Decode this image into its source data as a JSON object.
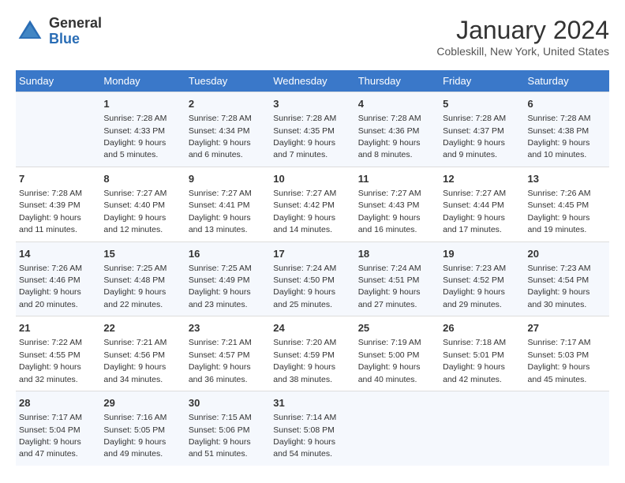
{
  "header": {
    "logo_general": "General",
    "logo_blue": "Blue",
    "month_title": "January 2024",
    "location": "Cobleskill, New York, United States"
  },
  "weekdays": [
    "Sunday",
    "Monday",
    "Tuesday",
    "Wednesday",
    "Thursday",
    "Friday",
    "Saturday"
  ],
  "weeks": [
    [
      {
        "day": "",
        "info": ""
      },
      {
        "day": "1",
        "info": "Sunrise: 7:28 AM\nSunset: 4:33 PM\nDaylight: 9 hours\nand 5 minutes."
      },
      {
        "day": "2",
        "info": "Sunrise: 7:28 AM\nSunset: 4:34 PM\nDaylight: 9 hours\nand 6 minutes."
      },
      {
        "day": "3",
        "info": "Sunrise: 7:28 AM\nSunset: 4:35 PM\nDaylight: 9 hours\nand 7 minutes."
      },
      {
        "day": "4",
        "info": "Sunrise: 7:28 AM\nSunset: 4:36 PM\nDaylight: 9 hours\nand 8 minutes."
      },
      {
        "day": "5",
        "info": "Sunrise: 7:28 AM\nSunset: 4:37 PM\nDaylight: 9 hours\nand 9 minutes."
      },
      {
        "day": "6",
        "info": "Sunrise: 7:28 AM\nSunset: 4:38 PM\nDaylight: 9 hours\nand 10 minutes."
      }
    ],
    [
      {
        "day": "7",
        "info": "Sunrise: 7:28 AM\nSunset: 4:39 PM\nDaylight: 9 hours\nand 11 minutes."
      },
      {
        "day": "8",
        "info": "Sunrise: 7:27 AM\nSunset: 4:40 PM\nDaylight: 9 hours\nand 12 minutes."
      },
      {
        "day": "9",
        "info": "Sunrise: 7:27 AM\nSunset: 4:41 PM\nDaylight: 9 hours\nand 13 minutes."
      },
      {
        "day": "10",
        "info": "Sunrise: 7:27 AM\nSunset: 4:42 PM\nDaylight: 9 hours\nand 14 minutes."
      },
      {
        "day": "11",
        "info": "Sunrise: 7:27 AM\nSunset: 4:43 PM\nDaylight: 9 hours\nand 16 minutes."
      },
      {
        "day": "12",
        "info": "Sunrise: 7:27 AM\nSunset: 4:44 PM\nDaylight: 9 hours\nand 17 minutes."
      },
      {
        "day": "13",
        "info": "Sunrise: 7:26 AM\nSunset: 4:45 PM\nDaylight: 9 hours\nand 19 minutes."
      }
    ],
    [
      {
        "day": "14",
        "info": "Sunrise: 7:26 AM\nSunset: 4:46 PM\nDaylight: 9 hours\nand 20 minutes."
      },
      {
        "day": "15",
        "info": "Sunrise: 7:25 AM\nSunset: 4:48 PM\nDaylight: 9 hours\nand 22 minutes."
      },
      {
        "day": "16",
        "info": "Sunrise: 7:25 AM\nSunset: 4:49 PM\nDaylight: 9 hours\nand 23 minutes."
      },
      {
        "day": "17",
        "info": "Sunrise: 7:24 AM\nSunset: 4:50 PM\nDaylight: 9 hours\nand 25 minutes."
      },
      {
        "day": "18",
        "info": "Sunrise: 7:24 AM\nSunset: 4:51 PM\nDaylight: 9 hours\nand 27 minutes."
      },
      {
        "day": "19",
        "info": "Sunrise: 7:23 AM\nSunset: 4:52 PM\nDaylight: 9 hours\nand 29 minutes."
      },
      {
        "day": "20",
        "info": "Sunrise: 7:23 AM\nSunset: 4:54 PM\nDaylight: 9 hours\nand 30 minutes."
      }
    ],
    [
      {
        "day": "21",
        "info": "Sunrise: 7:22 AM\nSunset: 4:55 PM\nDaylight: 9 hours\nand 32 minutes."
      },
      {
        "day": "22",
        "info": "Sunrise: 7:21 AM\nSunset: 4:56 PM\nDaylight: 9 hours\nand 34 minutes."
      },
      {
        "day": "23",
        "info": "Sunrise: 7:21 AM\nSunset: 4:57 PM\nDaylight: 9 hours\nand 36 minutes."
      },
      {
        "day": "24",
        "info": "Sunrise: 7:20 AM\nSunset: 4:59 PM\nDaylight: 9 hours\nand 38 minutes."
      },
      {
        "day": "25",
        "info": "Sunrise: 7:19 AM\nSunset: 5:00 PM\nDaylight: 9 hours\nand 40 minutes."
      },
      {
        "day": "26",
        "info": "Sunrise: 7:18 AM\nSunset: 5:01 PM\nDaylight: 9 hours\nand 42 minutes."
      },
      {
        "day": "27",
        "info": "Sunrise: 7:17 AM\nSunset: 5:03 PM\nDaylight: 9 hours\nand 45 minutes."
      }
    ],
    [
      {
        "day": "28",
        "info": "Sunrise: 7:17 AM\nSunset: 5:04 PM\nDaylight: 9 hours\nand 47 minutes."
      },
      {
        "day": "29",
        "info": "Sunrise: 7:16 AM\nSunset: 5:05 PM\nDaylight: 9 hours\nand 49 minutes."
      },
      {
        "day": "30",
        "info": "Sunrise: 7:15 AM\nSunset: 5:06 PM\nDaylight: 9 hours\nand 51 minutes."
      },
      {
        "day": "31",
        "info": "Sunrise: 7:14 AM\nSunset: 5:08 PM\nDaylight: 9 hours\nand 54 minutes."
      },
      {
        "day": "",
        "info": ""
      },
      {
        "day": "",
        "info": ""
      },
      {
        "day": "",
        "info": ""
      }
    ]
  ]
}
